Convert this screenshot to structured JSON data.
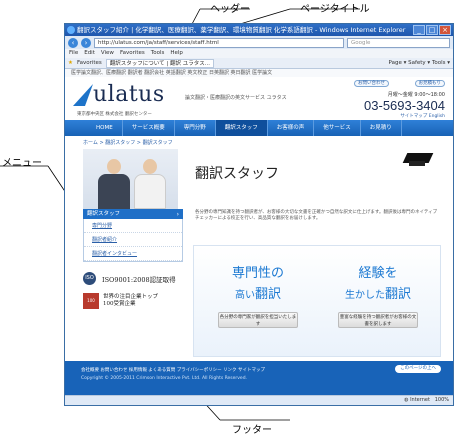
{
  "annotations": {
    "header": "ヘッダー",
    "page_title": "ページタイトル",
    "menu": "メニュー",
    "footer": "フッター"
  },
  "browser": {
    "title": "翻訳スタッフ紹介 | 化学翻訳、医療翻訳、薬学翻訳、環境物質翻訳 化学系語翻訳 - Windows Internet Explorer",
    "url": "http://ulatus.com/ja/staff/services/staff.html",
    "search_placeholder": "Google",
    "menu": [
      "File",
      "Edit",
      "View",
      "Favorites",
      "Tools",
      "Help"
    ],
    "favorites_label": "Favorites",
    "tab_label": "翻訳スタッフについて | 翻訳 ユラタス...",
    "toolbar_right": "Page ▾  Safety ▾  Tools ▾",
    "status_left": "",
    "status_zone": "Internet",
    "zoom": "100%"
  },
  "site": {
    "top_links": "医学論文翻訳、医療翻訳 翻訳者 翻訳会社 英語翻訳 英文校正 日英翻訳 英日翻訳 医学論文",
    "logo_text": "ulatus",
    "tagline": "論文翻訳・医療翻訳の英文サービス ユラタス",
    "pill_contact": "お問い合わせ",
    "pill_quote": "お見積もり",
    "hours": "月曜〜金曜 9:00〜18:00",
    "phone": "03-5693-3404",
    "sub_info": "東京都中央区 株式会社 翻訳センター",
    "sub_links": "サイトマップ  English",
    "nav": [
      "HOME",
      "サービス概要",
      "専門分野",
      "翻訳スタッフ",
      "お客様の声",
      "他サービス",
      "お見積り"
    ],
    "breadcrumb": "ホーム > 翻訳スタッフ > 翻訳スタッフ",
    "page_title": "翻訳スタッフ",
    "intro": "各分野の専門知識を持つ翻訳者が、お客様の大切な文書を正確かつ自然な訳文に仕上げます。翻訳後は専門のネイティブチェッカーによる校正を行い、高品質な翻訳をお届けします。"
  },
  "sidebar": {
    "heading": "翻訳スタッフ",
    "items": [
      "専門分野",
      "翻訳者紹介",
      "翻訳者インタビュー"
    ],
    "cert1": "ISO9001:2008認証取得",
    "cert2_line1": "世界の注目企業トップ",
    "cert2_line2": "100受賞企業",
    "seal1": "ISO",
    "seal2": "100"
  },
  "banner": {
    "left_line1": "専門性の",
    "left_line2a": "高い",
    "left_line2b": "翻訳",
    "left_btn": "各分野の専門家が翻訳を担当いたします",
    "right_line1": "経験を",
    "right_line2a": "生かした",
    "right_line2b": "翻訳",
    "right_btn": "豊富な経験を持つ翻訳者がお客様の文書を訳します"
  },
  "footer": {
    "links": "会社概要  お問い合わせ  採用情報  よくある質問  プライバシーポリシー  リンク  サイトマップ",
    "copyright": "Copyright © 2005-2011 Crimson Interactive Pvt. Ltd. All Rights Reserved.",
    "top_btn": "このページの上へ"
  }
}
